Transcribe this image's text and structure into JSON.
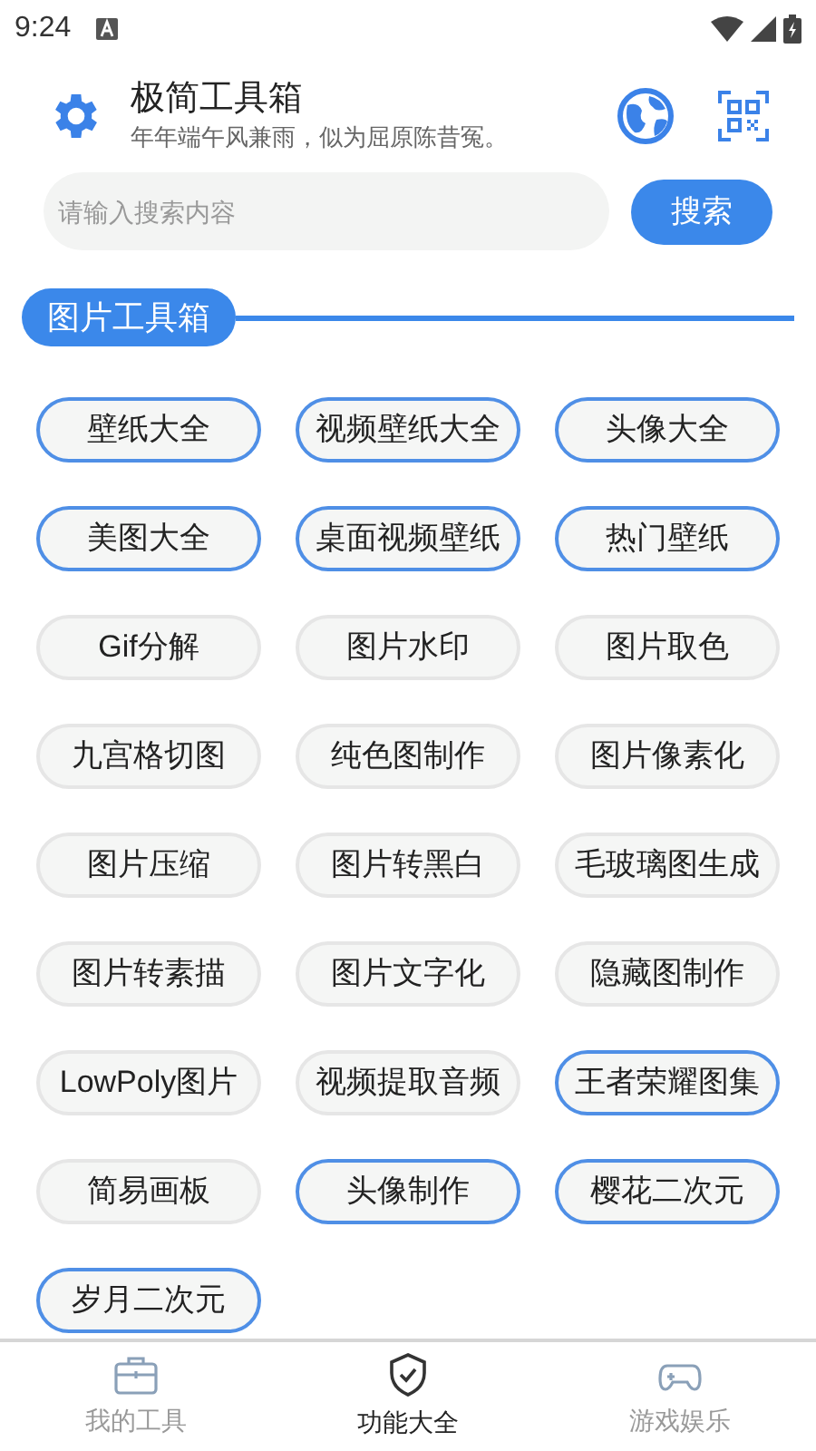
{
  "status_bar": {
    "time": "9:24"
  },
  "header": {
    "title": "极简工具箱",
    "subtitle": "年年端午风兼雨，似为屈原陈昔冤。"
  },
  "search": {
    "placeholder": "请输入搜索内容",
    "button": "搜索"
  },
  "section": {
    "title": "图片工具箱"
  },
  "tools": [
    {
      "label": "壁纸大全",
      "highlighted": true
    },
    {
      "label": "视频壁纸大全",
      "highlighted": true
    },
    {
      "label": "头像大全",
      "highlighted": true
    },
    {
      "label": "美图大全",
      "highlighted": true
    },
    {
      "label": "桌面视频壁纸",
      "highlighted": true
    },
    {
      "label": "热门壁纸",
      "highlighted": true
    },
    {
      "label": "Gif分解",
      "highlighted": false
    },
    {
      "label": "图片水印",
      "highlighted": false
    },
    {
      "label": "图片取色",
      "highlighted": false
    },
    {
      "label": "九宫格切图",
      "highlighted": false
    },
    {
      "label": "纯色图制作",
      "highlighted": false
    },
    {
      "label": "图片像素化",
      "highlighted": false
    },
    {
      "label": "图片压缩",
      "highlighted": false
    },
    {
      "label": "图片转黑白",
      "highlighted": false
    },
    {
      "label": "毛玻璃图生成",
      "highlighted": false
    },
    {
      "label": "图片转素描",
      "highlighted": false
    },
    {
      "label": "图片文字化",
      "highlighted": false
    },
    {
      "label": "隐藏图制作",
      "highlighted": false
    },
    {
      "label": "LowPoly图片",
      "highlighted": false
    },
    {
      "label": "视频提取音频",
      "highlighted": false
    },
    {
      "label": "王者荣耀图集",
      "highlighted": true
    },
    {
      "label": "简易画板",
      "highlighted": false
    },
    {
      "label": "头像制作",
      "highlighted": true
    },
    {
      "label": "樱花二次元",
      "highlighted": true
    },
    {
      "label": "岁月二次元",
      "highlighted": true
    }
  ],
  "bottom_nav": [
    {
      "kind": "toolbox",
      "label": "我的工具",
      "selected": false
    },
    {
      "kind": "shield",
      "label": "功能大全",
      "selected": true
    },
    {
      "kind": "game",
      "label": "游戏娱乐",
      "selected": false
    }
  ]
}
